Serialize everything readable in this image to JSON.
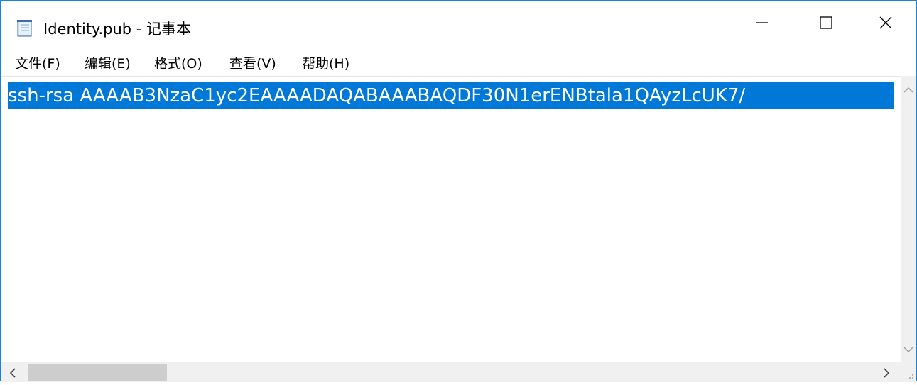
{
  "window": {
    "title": "Identity.pub - 记事本",
    "accent": "#1883d7",
    "app_icon": "notepad-icon"
  },
  "title_controls": {
    "minimize_icon": "minimize-icon",
    "maximize_icon": "maximize-icon",
    "close_icon": "close-icon"
  },
  "menu": {
    "items": [
      {
        "label": "文件(F)"
      },
      {
        "label": "编辑(E)"
      },
      {
        "label": "格式(O)"
      },
      {
        "label": "查看(V)"
      },
      {
        "label": "帮助(H)"
      }
    ]
  },
  "editor": {
    "content": "ssh-rsa AAAAB3NzaC1yc2EAAAADAQABAAABAQDF30N1erENBtala1QAyzLcUK7/",
    "selection_color": "#0078d7"
  },
  "scrollbars": {
    "up_icon": "chevron-up-icon",
    "down_icon": "chevron-down-icon",
    "left_icon": "chevron-left-icon",
    "right_icon": "chevron-right-icon"
  }
}
